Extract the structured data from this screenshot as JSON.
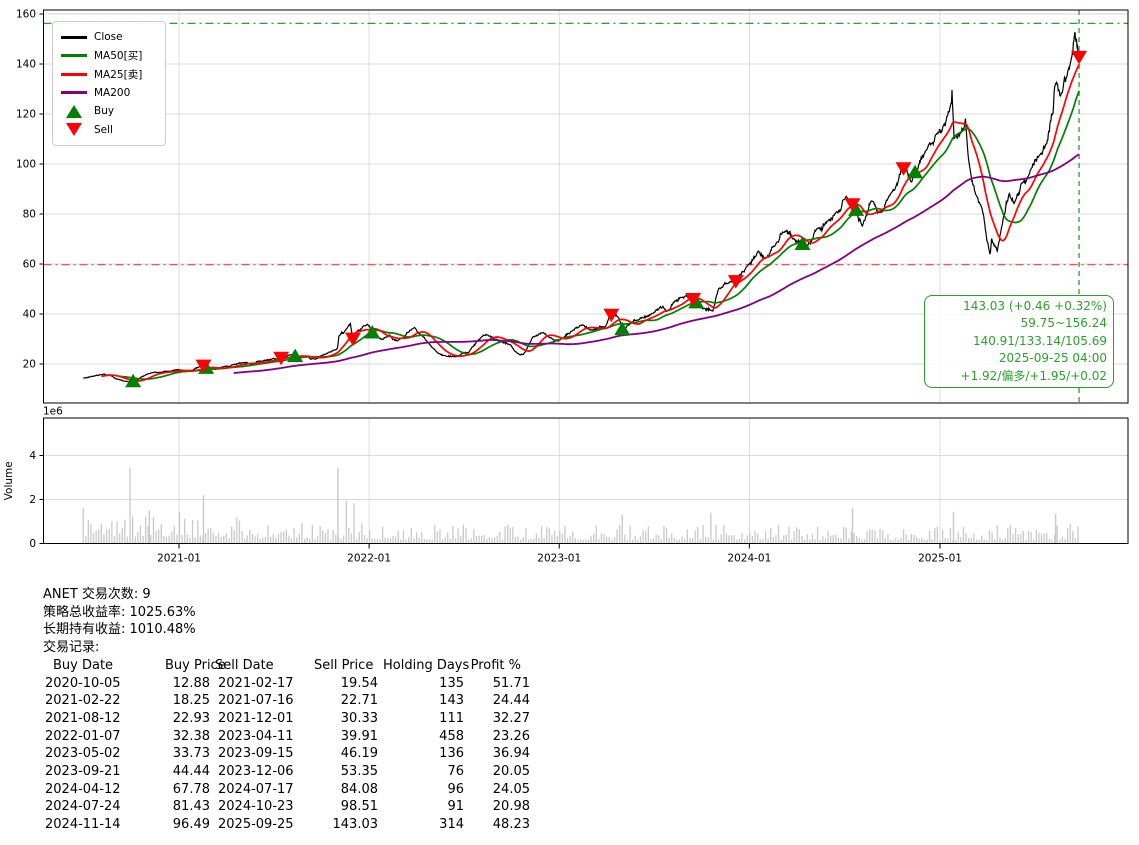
{
  "colors": {
    "close": "#000000",
    "ma50": "#008000",
    "ma25": "#ff0000",
    "ma200": "#800080",
    "buy": "#008000",
    "sell": "#ff0000",
    "hi_line": "#2ca02c",
    "lo_line": "#ff5050",
    "cursor": "#2ca02c",
    "annotation": "#2ca02c",
    "grid": "#d9d9d9",
    "volume_bar": "#c9c9c9",
    "axis": "#000000"
  },
  "legend": {
    "items": [
      {
        "label": "Close",
        "swatch": "line"
      },
      {
        "label": "MA50[买]",
        "swatch": "line"
      },
      {
        "label": "MA25[卖]",
        "swatch": "line"
      },
      {
        "label": "MA200",
        "swatch": "line"
      },
      {
        "label": "Buy",
        "swatch": "triangle-up"
      },
      {
        "label": "Sell",
        "swatch": "triangle-down"
      }
    ]
  },
  "price_axis": {
    "y_ticks": [
      20,
      40,
      60,
      80,
      100,
      120,
      140,
      160
    ],
    "x_ticks": [
      {
        "label": "2021-01",
        "date": "2021-01-01"
      },
      {
        "label": "2022-01",
        "date": "2022-01-01"
      },
      {
        "label": "2023-01",
        "date": "2023-01-01"
      },
      {
        "label": "2024-01",
        "date": "2024-01-01"
      },
      {
        "label": "2025-01",
        "date": "2025-01-01"
      }
    ],
    "hlines": [
      {
        "value": 156.24,
        "style": "dashdot",
        "color_key": "hi_line"
      },
      {
        "value": 59.75,
        "style": "dashdot",
        "color_key": "lo_line"
      }
    ],
    "vline": {
      "date": "2025-09-25",
      "style": "dashed",
      "color_key": "cursor"
    }
  },
  "volume_axis": {
    "ylabel": "Volume",
    "offset_label": "1e6",
    "y_ticks": [
      0,
      2,
      4
    ]
  },
  "annotation": {
    "lines": [
      "143.03 (+0.46 +0.32%)",
      "59.75~156.24",
      "140.91/133.14/105.69",
      "2025-09-25 04:00",
      "+1.92/偏多/+1.95/+0.02"
    ]
  },
  "stats_lines": [
    "ANET 交易次数: 9",
    "策略总收益率: 1025.63%",
    "长期持有收益: 1010.48%",
    "交易记录:"
  ],
  "trade_table": {
    "headers": [
      "Buy Date",
      "Buy Price",
      "Sell Date",
      "Sell Price",
      "Holding Days",
      "Profit %"
    ],
    "rows": [
      [
        "2020-10-05",
        "12.88",
        "2021-02-17",
        "19.54",
        "135",
        "51.71"
      ],
      [
        "2021-02-22",
        "18.25",
        "2021-07-16",
        "22.71",
        "143",
        "24.44"
      ],
      [
        "2021-08-12",
        "22.93",
        "2021-12-01",
        "30.33",
        "111",
        "32.27"
      ],
      [
        "2022-01-07",
        "32.38",
        "2023-04-11",
        "39.91",
        "458",
        "23.26"
      ],
      [
        "2023-05-02",
        "33.73",
        "2023-09-15",
        "46.19",
        "136",
        "36.94"
      ],
      [
        "2023-09-21",
        "44.44",
        "2023-12-06",
        "53.35",
        "76",
        "20.05"
      ],
      [
        "2024-04-12",
        "67.78",
        "2024-07-17",
        "84.08",
        "96",
        "24.05"
      ],
      [
        "2024-07-24",
        "81.43",
        "2024-10-23",
        "98.51",
        "91",
        "20.98"
      ],
      [
        "2024-11-14",
        "96.49",
        "2025-09-25",
        "143.03",
        "314",
        "48.23"
      ]
    ]
  },
  "chart_data": [
    {
      "type": "line",
      "title": "",
      "symbol": "ANET",
      "x_range": [
        "2020-07-01",
        "2025-09-25"
      ],
      "ylim": [
        3,
        162
      ],
      "grid": true,
      "legend_position": "upper-left",
      "series": [
        {
          "name": "Close",
          "color_key": "close",
          "points": [
            [
              "2020-07-01",
              14.3
            ],
            [
              "2020-07-20",
              15.1
            ],
            [
              "2020-08-10",
              16.0
            ],
            [
              "2020-08-24",
              15.3
            ],
            [
              "2020-09-08",
              13.8
            ],
            [
              "2020-09-23",
              13.1
            ],
            [
              "2020-10-05",
              12.88
            ],
            [
              "2020-10-19",
              14.6
            ],
            [
              "2020-11-04",
              16.1
            ],
            [
              "2020-11-23",
              16.6
            ],
            [
              "2020-12-14",
              17.1
            ],
            [
              "2021-01-04",
              17.6
            ],
            [
              "2021-01-25",
              17.3
            ],
            [
              "2021-02-09",
              18.9
            ],
            [
              "2021-02-17",
              19.54
            ],
            [
              "2021-02-22",
              18.25
            ],
            [
              "2021-03-08",
              17.9
            ],
            [
              "2021-03-29",
              19.0
            ],
            [
              "2021-04-16",
              19.8
            ],
            [
              "2021-05-04",
              20.6
            ],
            [
              "2021-05-19",
              19.9
            ],
            [
              "2021-06-10",
              21.1
            ],
            [
              "2021-07-01",
              22.3
            ],
            [
              "2021-07-16",
              22.71
            ],
            [
              "2021-08-02",
              23.6
            ],
            [
              "2021-08-12",
              22.93
            ],
            [
              "2021-08-31",
              23.2
            ],
            [
              "2021-09-20",
              21.9
            ],
            [
              "2021-10-08",
              23.8
            ],
            [
              "2021-10-26",
              25.6
            ],
            [
              "2021-11-01",
              26.3
            ],
            [
              "2021-11-04",
              31.2
            ],
            [
              "2021-11-19",
              34.2
            ],
            [
              "2021-11-26",
              36.2
            ],
            [
              "2021-12-01",
              30.33
            ],
            [
              "2021-12-10",
              33.5
            ],
            [
              "2021-12-29",
              35.9
            ],
            [
              "2022-01-07",
              32.38
            ],
            [
              "2022-01-27",
              29.8
            ],
            [
              "2022-02-09",
              31.6
            ],
            [
              "2022-02-24",
              29.2
            ],
            [
              "2022-03-29",
              34.6
            ],
            [
              "2022-04-26",
              28.2
            ],
            [
              "2022-05-12",
              24.6
            ],
            [
              "2022-05-26",
              23.4
            ],
            [
              "2022-06-16",
              22.9
            ],
            [
              "2022-07-11",
              24.6
            ],
            [
              "2022-08-04",
              30.6
            ],
            [
              "2022-08-16",
              31.6
            ],
            [
              "2022-09-06",
              29.2
            ],
            [
              "2022-09-30",
              27.6
            ],
            [
              "2022-10-13",
              24.2
            ],
            [
              "2022-10-24",
              23.8
            ],
            [
              "2022-11-11",
              30.8
            ],
            [
              "2022-12-01",
              32.6
            ],
            [
              "2022-12-22",
              29.6
            ],
            [
              "2023-01-05",
              30.1
            ],
            [
              "2023-01-26",
              33.2
            ],
            [
              "2023-02-14",
              35.6
            ],
            [
              "2023-03-02",
              33.6
            ],
            [
              "2023-03-31",
              35.0
            ],
            [
              "2023-04-11",
              39.91
            ],
            [
              "2023-04-25",
              38.6
            ],
            [
              "2023-05-02",
              33.73
            ],
            [
              "2023-05-17",
              36.1
            ],
            [
              "2023-06-02",
              37.6
            ],
            [
              "2023-06-30",
              40.3
            ],
            [
              "2023-07-19",
              43.1
            ],
            [
              "2023-07-28",
              41.2
            ],
            [
              "2023-08-08",
              44.6
            ],
            [
              "2023-08-24",
              46.6
            ],
            [
              "2023-09-15",
              46.19
            ],
            [
              "2023-09-21",
              44.44
            ],
            [
              "2023-10-03",
              42.1
            ],
            [
              "2023-10-23",
              41.2
            ],
            [
              "2023-11-03",
              50.1
            ],
            [
              "2023-11-21",
              52.2
            ],
            [
              "2023-12-06",
              53.35
            ],
            [
              "2023-12-28",
              59.2
            ],
            [
              "2024-01-18",
              65.2
            ],
            [
              "2024-02-01",
              62.3
            ],
            [
              "2024-02-20",
              67.6
            ],
            [
              "2024-03-07",
              72.6
            ],
            [
              "2024-03-26",
              70.1
            ],
            [
              "2024-04-12",
              67.78
            ],
            [
              "2024-04-19",
              66.2
            ],
            [
              "2024-05-10",
              74.2
            ],
            [
              "2024-05-31",
              77.2
            ],
            [
              "2024-06-14",
              80.2
            ],
            [
              "2024-07-05",
              87.1
            ],
            [
              "2024-07-17",
              84.08
            ],
            [
              "2024-07-24",
              81.43
            ],
            [
              "2024-08-05",
              75.2
            ],
            [
              "2024-08-22",
              85.2
            ],
            [
              "2024-09-06",
              80.6
            ],
            [
              "2024-09-25",
              87.2
            ],
            [
              "2024-10-07",
              90.2
            ],
            [
              "2024-10-23",
              98.51
            ],
            [
              "2024-11-01",
              95.2
            ],
            [
              "2024-11-07",
              92.8
            ],
            [
              "2024-11-14",
              96.49
            ],
            [
              "2024-12-06",
              105.6
            ],
            [
              "2024-12-26",
              112.2
            ],
            [
              "2025-01-07",
              115.2
            ],
            [
              "2025-01-22",
              124.2
            ],
            [
              "2025-01-24",
              129.6
            ],
            [
              "2025-01-28",
              110.2
            ],
            [
              "2025-02-10",
              112.6
            ],
            [
              "2025-02-19",
              118.2
            ],
            [
              "2025-02-26",
              100.2
            ],
            [
              "2025-03-10",
              88.2
            ],
            [
              "2025-03-25",
              80.2
            ],
            [
              "2025-04-07",
              63.9
            ],
            [
              "2025-04-10",
              70.2
            ],
            [
              "2025-04-21",
              65.2
            ],
            [
              "2025-04-30",
              75.3
            ],
            [
              "2025-05-14",
              88.2
            ],
            [
              "2025-05-23",
              84.2
            ],
            [
              "2025-06-06",
              92.2
            ],
            [
              "2025-06-25",
              98.2
            ],
            [
              "2025-07-10",
              103.2
            ],
            [
              "2025-07-25",
              108.2
            ],
            [
              "2025-08-06",
              120.2
            ],
            [
              "2025-08-11",
              132.2
            ],
            [
              "2025-08-20",
              127.2
            ],
            [
              "2025-09-02",
              135.2
            ],
            [
              "2025-09-10",
              142.2
            ],
            [
              "2025-09-17",
              152.8
            ],
            [
              "2025-09-22",
              147.2
            ],
            [
              "2025-09-25",
              143.03
            ]
          ]
        },
        {
          "name": "MA50[买]",
          "color_key": "ma50",
          "derived": "moving_average_of_close",
          "window_days": 72
        },
        {
          "name": "MA25[卖]",
          "color_key": "ma25",
          "derived": "moving_average_of_close",
          "window_days": 36
        },
        {
          "name": "MA200",
          "color_key": "ma200",
          "derived": "moving_average_of_close",
          "window_days": 290
        }
      ],
      "markers": {
        "buy": [
          [
            "2020-10-05",
            12.88
          ],
          [
            "2021-02-22",
            18.25
          ],
          [
            "2021-08-12",
            22.93
          ],
          [
            "2022-01-07",
            32.38
          ],
          [
            "2023-05-02",
            33.73
          ],
          [
            "2023-09-21",
            44.44
          ],
          [
            "2024-04-12",
            67.78
          ],
          [
            "2024-07-24",
            81.43
          ],
          [
            "2024-11-14",
            96.49
          ]
        ],
        "sell": [
          [
            "2021-02-17",
            19.54
          ],
          [
            "2021-07-16",
            22.71
          ],
          [
            "2021-12-01",
            30.33
          ],
          [
            "2023-04-11",
            39.91
          ],
          [
            "2023-09-15",
            46.19
          ],
          [
            "2023-12-06",
            53.35
          ],
          [
            "2024-07-17",
            84.08
          ],
          [
            "2024-10-23",
            98.51
          ],
          [
            "2025-09-25",
            143.03
          ]
        ]
      }
    },
    {
      "type": "bar",
      "name": "Volume",
      "unit": "1e6",
      "ylim": [
        0,
        5.7
      ],
      "profile": [
        [
          "2020-07-01",
          0.85
        ],
        [
          "2020-12-01",
          0.8
        ],
        [
          "2021-04-01",
          0.6
        ],
        [
          "2021-09-01",
          0.5
        ],
        [
          "2022-01-01",
          0.48
        ],
        [
          "2023-01-01",
          0.44
        ],
        [
          "2024-01-01",
          0.46
        ],
        [
          "2025-01-01",
          0.4
        ],
        [
          "2025-09-25",
          0.5
        ]
      ],
      "spikes": [
        [
          "2020-11-05",
          1.5
        ],
        [
          "2021-02-17",
          2.2
        ],
        [
          "2021-11-02",
          3.45
        ],
        [
          "2023-05-02",
          1.3
        ],
        [
          "2024-07-17",
          1.6
        ],
        [
          "2025-01-27",
          1.45
        ],
        [
          "2025-08-11",
          1.35
        ]
      ]
    }
  ]
}
